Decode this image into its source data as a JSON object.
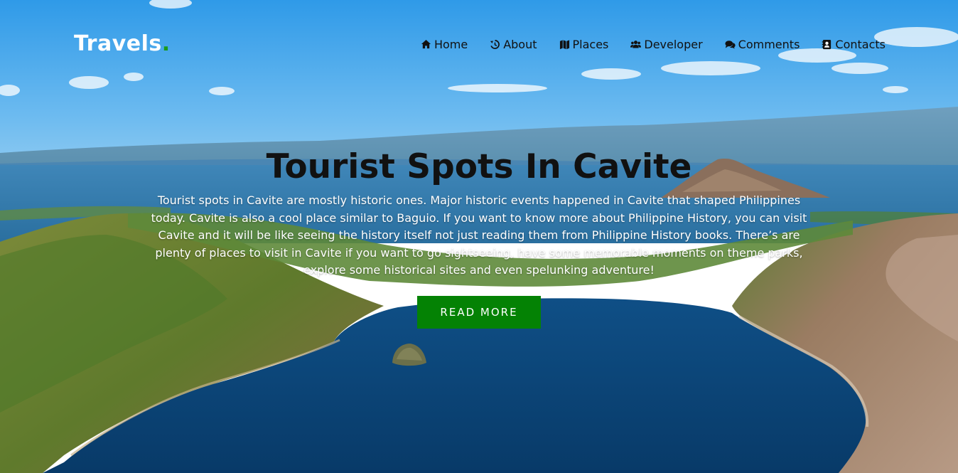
{
  "brand": {
    "name": "Travels",
    "dot": ".",
    "accent_color": "#1a9a1a"
  },
  "nav": {
    "items": [
      {
        "label": "Home",
        "icon": "home-icon"
      },
      {
        "label": "About",
        "icon": "history-icon"
      },
      {
        "label": "Places",
        "icon": "map-icon"
      },
      {
        "label": "Developer",
        "icon": "users-icon"
      },
      {
        "label": "Comments",
        "icon": "comments-icon"
      },
      {
        "label": "Contacts",
        "icon": "address-book-icon"
      }
    ]
  },
  "hero": {
    "title": "Tourist Spots In Cavite",
    "description": "Tourist spots in Cavite are mostly historic ones. Major historic events happened in Cavite that shaped Philippines today. Cavite is also a cool place similar to Baguio. If you want to know more about Philippine History, you can visit Cavite and it will be like seeing the history itself not just reading them from Philippine History books. There’s are plenty of places to visit in Cavite if you want to go sightseeing, have some memorable moments on theme parks, explore some historical sites and even spelunking adventure!",
    "button_label": "READ MORE",
    "button_color": "#048204",
    "background": "taal-volcano-lake-landscape"
  }
}
